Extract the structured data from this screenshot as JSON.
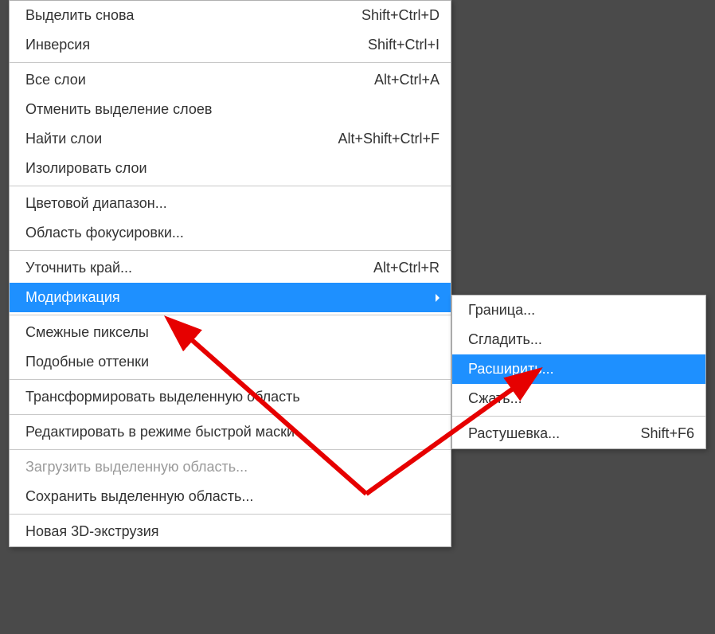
{
  "mainMenu": {
    "reselect": {
      "label": "Выделить снова",
      "shortcut": "Shift+Ctrl+D"
    },
    "inverse": {
      "label": "Инверсия",
      "shortcut": "Shift+Ctrl+I"
    },
    "allLayers": {
      "label": "Все слои",
      "shortcut": "Alt+Ctrl+A"
    },
    "deselectLayers": {
      "label": "Отменить выделение слоев"
    },
    "findLayers": {
      "label": "Найти слои",
      "shortcut": "Alt+Shift+Ctrl+F"
    },
    "isolateLayers": {
      "label": "Изолировать слои"
    },
    "colorRange": {
      "label": "Цветовой диапазон..."
    },
    "focusArea": {
      "label": "Область фокусировки..."
    },
    "refineEdge": {
      "label": "Уточнить край...",
      "shortcut": "Alt+Ctrl+R"
    },
    "modify": {
      "label": "Модификация"
    },
    "grow": {
      "label": "Смежные пикселы"
    },
    "similar": {
      "label": "Подобные оттенки"
    },
    "transform": {
      "label": "Трансформировать выделенную область"
    },
    "quickMask": {
      "label": "Редактировать в режиме быстрой маски"
    },
    "load": {
      "label": "Загрузить выделенную область..."
    },
    "save": {
      "label": "Сохранить выделенную область..."
    },
    "new3d": {
      "label": "Новая 3D-экструзия"
    }
  },
  "subMenu": {
    "border": {
      "label": "Граница..."
    },
    "smooth": {
      "label": "Сгладить..."
    },
    "expand": {
      "label": "Расширить..."
    },
    "contract": {
      "label": "Сжать..."
    },
    "feather": {
      "label": "Растушевка...",
      "shortcut": "Shift+F6"
    }
  }
}
